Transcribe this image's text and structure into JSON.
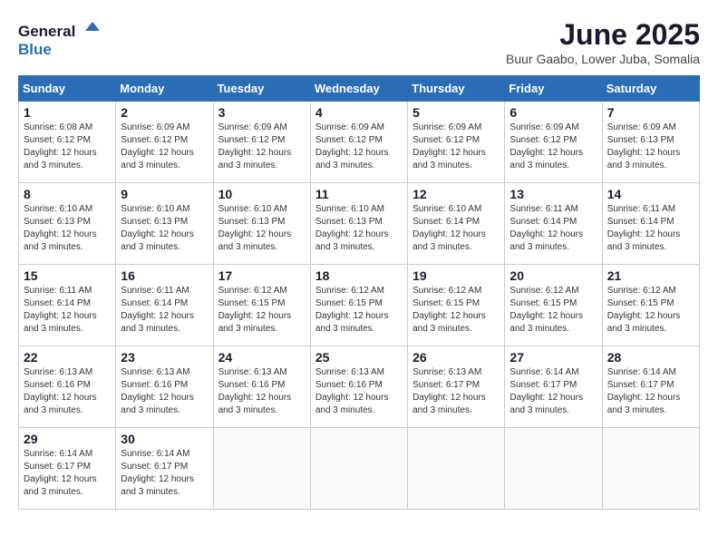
{
  "header": {
    "logo_general": "General",
    "logo_blue": "Blue",
    "month": "June 2025",
    "location": "Buur Gaabo, Lower Juba, Somalia"
  },
  "weekdays": [
    "Sunday",
    "Monday",
    "Tuesday",
    "Wednesday",
    "Thursday",
    "Friday",
    "Saturday"
  ],
  "weeks": [
    [
      {
        "day": "1",
        "sunrise": "6:08 AM",
        "sunset": "6:12 PM",
        "daylight": "12 hours and 3 minutes."
      },
      {
        "day": "2",
        "sunrise": "6:09 AM",
        "sunset": "6:12 PM",
        "daylight": "12 hours and 3 minutes."
      },
      {
        "day": "3",
        "sunrise": "6:09 AM",
        "sunset": "6:12 PM",
        "daylight": "12 hours and 3 minutes."
      },
      {
        "day": "4",
        "sunrise": "6:09 AM",
        "sunset": "6:12 PM",
        "daylight": "12 hours and 3 minutes."
      },
      {
        "day": "5",
        "sunrise": "6:09 AM",
        "sunset": "6:12 PM",
        "daylight": "12 hours and 3 minutes."
      },
      {
        "day": "6",
        "sunrise": "6:09 AM",
        "sunset": "6:12 PM",
        "daylight": "12 hours and 3 minutes."
      },
      {
        "day": "7",
        "sunrise": "6:09 AM",
        "sunset": "6:13 PM",
        "daylight": "12 hours and 3 minutes."
      }
    ],
    [
      {
        "day": "8",
        "sunrise": "6:10 AM",
        "sunset": "6:13 PM",
        "daylight": "12 hours and 3 minutes."
      },
      {
        "day": "9",
        "sunrise": "6:10 AM",
        "sunset": "6:13 PM",
        "daylight": "12 hours and 3 minutes."
      },
      {
        "day": "10",
        "sunrise": "6:10 AM",
        "sunset": "6:13 PM",
        "daylight": "12 hours and 3 minutes."
      },
      {
        "day": "11",
        "sunrise": "6:10 AM",
        "sunset": "6:13 PM",
        "daylight": "12 hours and 3 minutes."
      },
      {
        "day": "12",
        "sunrise": "6:10 AM",
        "sunset": "6:14 PM",
        "daylight": "12 hours and 3 minutes."
      },
      {
        "day": "13",
        "sunrise": "6:11 AM",
        "sunset": "6:14 PM",
        "daylight": "12 hours and 3 minutes."
      },
      {
        "day": "14",
        "sunrise": "6:11 AM",
        "sunset": "6:14 PM",
        "daylight": "12 hours and 3 minutes."
      }
    ],
    [
      {
        "day": "15",
        "sunrise": "6:11 AM",
        "sunset": "6:14 PM",
        "daylight": "12 hours and 3 minutes."
      },
      {
        "day": "16",
        "sunrise": "6:11 AM",
        "sunset": "6:14 PM",
        "daylight": "12 hours and 3 minutes."
      },
      {
        "day": "17",
        "sunrise": "6:12 AM",
        "sunset": "6:15 PM",
        "daylight": "12 hours and 3 minutes."
      },
      {
        "day": "18",
        "sunrise": "6:12 AM",
        "sunset": "6:15 PM",
        "daylight": "12 hours and 3 minutes."
      },
      {
        "day": "19",
        "sunrise": "6:12 AM",
        "sunset": "6:15 PM",
        "daylight": "12 hours and 3 minutes."
      },
      {
        "day": "20",
        "sunrise": "6:12 AM",
        "sunset": "6:15 PM",
        "daylight": "12 hours and 3 minutes."
      },
      {
        "day": "21",
        "sunrise": "6:12 AM",
        "sunset": "6:15 PM",
        "daylight": "12 hours and 3 minutes."
      }
    ],
    [
      {
        "day": "22",
        "sunrise": "6:13 AM",
        "sunset": "6:16 PM",
        "daylight": "12 hours and 3 minutes."
      },
      {
        "day": "23",
        "sunrise": "6:13 AM",
        "sunset": "6:16 PM",
        "daylight": "12 hours and 3 minutes."
      },
      {
        "day": "24",
        "sunrise": "6:13 AM",
        "sunset": "6:16 PM",
        "daylight": "12 hours and 3 minutes."
      },
      {
        "day": "25",
        "sunrise": "6:13 AM",
        "sunset": "6:16 PM",
        "daylight": "12 hours and 3 minutes."
      },
      {
        "day": "26",
        "sunrise": "6:13 AM",
        "sunset": "6:17 PM",
        "daylight": "12 hours and 3 minutes."
      },
      {
        "day": "27",
        "sunrise": "6:14 AM",
        "sunset": "6:17 PM",
        "daylight": "12 hours and 3 minutes."
      },
      {
        "day": "28",
        "sunrise": "6:14 AM",
        "sunset": "6:17 PM",
        "daylight": "12 hours and 3 minutes."
      }
    ],
    [
      {
        "day": "29",
        "sunrise": "6:14 AM",
        "sunset": "6:17 PM",
        "daylight": "12 hours and 3 minutes."
      },
      {
        "day": "30",
        "sunrise": "6:14 AM",
        "sunset": "6:17 PM",
        "daylight": "12 hours and 3 minutes."
      },
      null,
      null,
      null,
      null,
      null
    ]
  ],
  "labels": {
    "sunrise": "Sunrise:",
    "sunset": "Sunset:",
    "daylight": "Daylight:"
  }
}
